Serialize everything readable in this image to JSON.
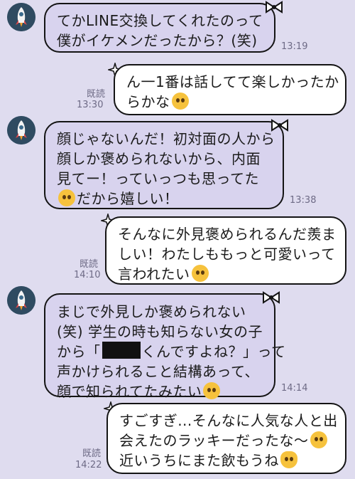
{
  "messages": [
    {
      "side": "in",
      "lines": [
        "てかLINE交換してくれたのって",
        "僕がイケメンだったから？(笑)"
      ],
      "time": "13:19"
    },
    {
      "side": "out",
      "lines": [
        "ん一1番は話してて楽しかったか",
        "らかな"
      ],
      "read": "既読",
      "time": "13:30",
      "emoji": "pleading-face-emoji"
    },
    {
      "side": "in",
      "lines": [
        "顔じゃないんだ！初対面の人から",
        "顔しか褒められないから、内面",
        "見てー！っていっつも思ってた",
        "だから嬉しい！"
      ],
      "time": "13:38",
      "emoji": "crying-face-emoji"
    },
    {
      "side": "out",
      "lines": [
        "そんなに外見褒められるんだ羨ま",
        "しい！わたしももっと可愛いって",
        "言われたい"
      ],
      "read": "既読",
      "time": "14:10",
      "emoji": "pleading-face-emoji"
    },
    {
      "side": "in",
      "lines": [
        "まじで外見しか褒められない",
        "(笑) 学生の時も知らない女の子",
        "から「",
        "くんですよね？」って",
        "声かけられること結構あって、",
        "顔で知られてたみたい"
      ],
      "time": "14:14",
      "emoji": "thinking-face-emoji",
      "redacted": "name-redaction"
    },
    {
      "side": "out",
      "lines": [
        "すごすぎ...そんなに人気な人と出",
        "会えたのラッキーだったな〜",
        "近いうちにまた飲もうね"
      ],
      "read": "既読",
      "time": "14:22",
      "emoji": [
        "smiling-face-with-hearts-emoji",
        "heart-hands-emoji"
      ]
    }
  ],
  "colors": {
    "background": "#dfdcef",
    "incoming_bubble": "#d8d3ee",
    "outgoing_bubble": "#ffffff",
    "avatar": "#2f4b61"
  }
}
